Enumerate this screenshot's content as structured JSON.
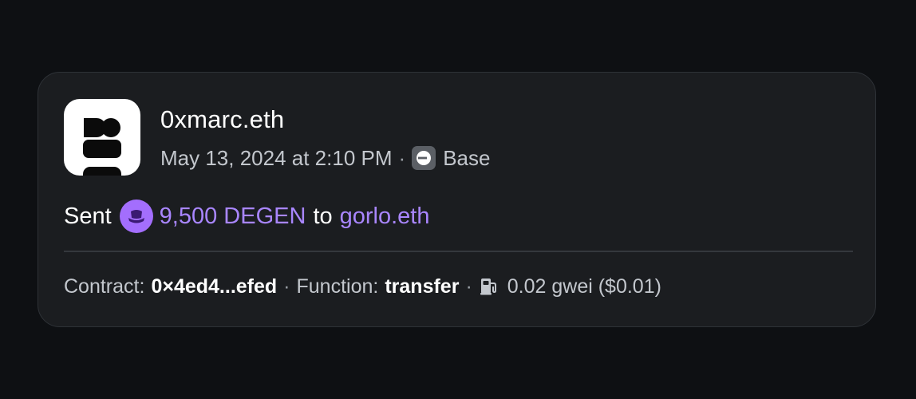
{
  "activity": {
    "username": "0xmarc.eth",
    "date": "May 13, 2024 at 2:10 PM",
    "separator": "·",
    "chain": "Base",
    "chain_icon": "base-chain-icon",
    "action": "Sent",
    "token_icon": "degen-token-icon",
    "amount": "9,500 DEGEN",
    "to_word": "to",
    "recipient": "gorlo.eth",
    "accent_color": "#a986ff"
  },
  "footer": {
    "contract_label": "Contract:",
    "contract_value": "0×4ed4...efed",
    "function_label": "Function:",
    "function_value": "transfer",
    "gas_icon": "gas-pump-icon",
    "gas_value": "0.02 gwei ($0.01)"
  }
}
